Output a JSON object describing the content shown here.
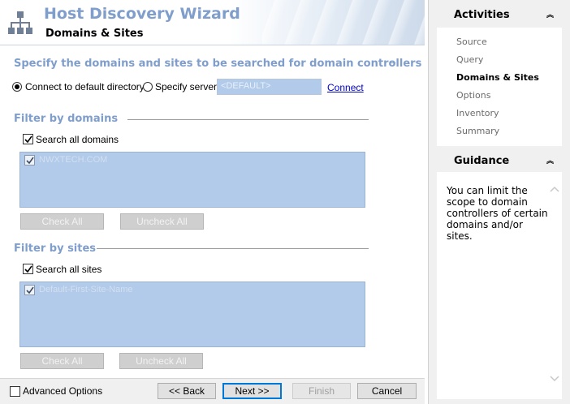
{
  "header": {
    "title": "Host Discovery Wizard",
    "subtitle": "Domains & Sites"
  },
  "main": {
    "instruction": "Specify the domains and sites to be searched for domain controllers",
    "collapse_glyph": "–",
    "connect_default_label": "Connect to default directory",
    "specify_server_label": "Specify server",
    "server_placeholder": "<DEFAULT>",
    "connect_link": "Connect",
    "domains": {
      "heading": "Filter by domains",
      "search_all_label": "Search all domains",
      "items": [
        "NWXTECH.COM"
      ],
      "check_all": "Check All",
      "uncheck_all": "Uncheck All"
    },
    "sites": {
      "heading": "Filter by sites",
      "search_all_label": "Search all sites",
      "items": [
        "Default-First-Site-Name"
      ],
      "check_all": "Check All",
      "uncheck_all": "Uncheck All"
    }
  },
  "footer": {
    "advanced_options": "Advanced Options",
    "back": "<< Back",
    "next": "Next >>",
    "finish": "Finish",
    "cancel": "Cancel"
  },
  "activities": {
    "title": "Activities",
    "items": [
      "Source",
      "Query",
      "Domains & Sites",
      "Options",
      "Inventory",
      "Summary"
    ],
    "current": "Domains & Sites"
  },
  "guidance": {
    "title": "Guidance",
    "lines": [
      "You can limit the",
      "scope to domain",
      "controllers of certain",
      "domains and/or",
      "sites."
    ]
  },
  "colors": {
    "accent_text": "#7f9ecb",
    "list_background": "#b3cbea",
    "link": "#0000cc",
    "default_button_border": "#0078d7"
  },
  "icons": {
    "wizard_icon": "network-hierarchy-icon",
    "collapse": "chevron-double-up-icon",
    "scroll_up": "chevron-up-icon",
    "scroll_down": "chevron-down-icon"
  }
}
